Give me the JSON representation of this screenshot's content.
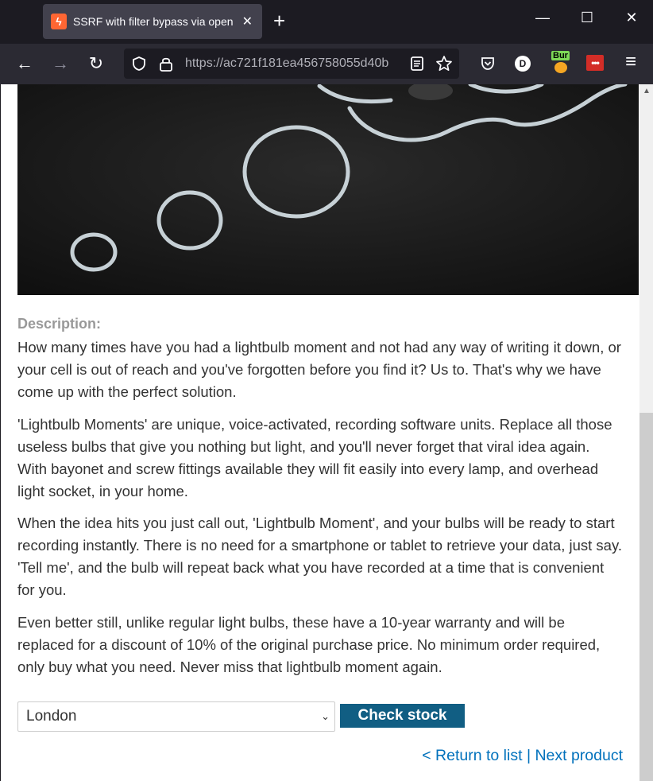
{
  "browser": {
    "tab": {
      "title": "SSRF with filter bypass via open",
      "close_glyph": "✕"
    },
    "new_tab_glyph": "+",
    "window_controls": {
      "minimize": "—",
      "maximize": "☐",
      "close": "✕"
    },
    "toolbar": {
      "back_glyph": "←",
      "forward_glyph": "→",
      "reload_glyph": "↻",
      "url": "https://ac721f181ea456758055d40b",
      "extensions": {
        "d_label": "D",
        "burp_label": "Bur",
        "lastpass_label": "•••"
      },
      "menu_glyph": "≡"
    }
  },
  "page": {
    "description_label": "Description:",
    "paragraphs": [
      "How many times have you had a lightbulb moment and not had any way of writing it down, or your cell is out of reach and you've forgotten before you find it? Us to. That's why we have come up with the perfect solution.",
      "'Lightbulb Moments' are unique, voice-activated, recording software units. Replace all those useless bulbs that give you nothing but light, and you'll never forget that viral idea again. With bayonet and screw fittings available they will fit easily into every lamp, and overhead light socket, in your home.",
      "When the idea hits you just call out, 'Lightbulb Moment', and your bulbs will be ready to start recording instantly. There is no need for a smartphone or tablet to retrieve your data, just say. 'Tell me', and the bulb will repeat back what you have recorded at a time that is convenient for you.",
      "Even better still, unlike regular light bulbs, these have a 10-year warranty and will be replaced for a discount of 10% of the original purchase price. No minimum order required, only buy what you need. Never miss that lightbulb moment again."
    ],
    "stock": {
      "selected_store": "London",
      "check_button": "Check stock"
    },
    "links": {
      "return": "< Return to list",
      "separator": "|",
      "next": "Next product"
    }
  },
  "colors": {
    "accent_button": "#115e83",
    "link": "#0071bc",
    "favicon": "#ff6633"
  }
}
